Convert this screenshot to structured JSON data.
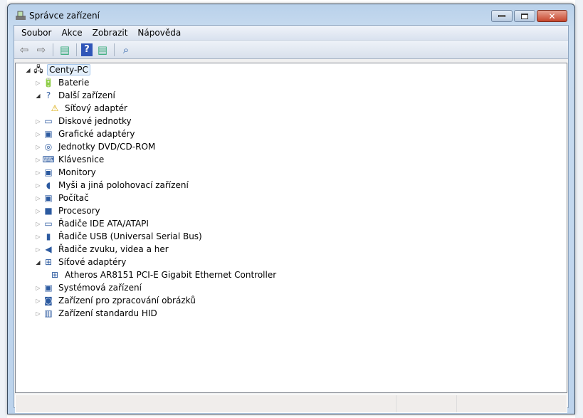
{
  "window": {
    "title": "Správce zařízení",
    "minimize": "—",
    "maximize": "□",
    "close": "✕"
  },
  "menu": [
    "Soubor",
    "Akce",
    "Zobrazit",
    "Nápověda"
  ],
  "toolbar": [
    {
      "name": "back",
      "glyph": "⇦"
    },
    {
      "name": "forward",
      "glyph": "⇨"
    },
    {
      "name": "show-hide-tree",
      "glyph": "▤"
    },
    {
      "name": "help",
      "glyph": "?"
    },
    {
      "name": "properties",
      "glyph": "▤"
    },
    {
      "name": "scan-hardware",
      "glyph": "⌕"
    }
  ],
  "tree": {
    "root": "Centy-PC",
    "items": [
      {
        "label": "Baterie",
        "level": 1,
        "expanded": false,
        "icon": "battery-icon",
        "glyph": "🔋"
      },
      {
        "label": "Další zařízení",
        "level": 1,
        "expanded": true,
        "icon": "unknown-device-icon",
        "glyph": "?"
      },
      {
        "label": "Síťový adaptér",
        "level": 2,
        "icon": "warning-device-icon",
        "glyph": "⚠"
      },
      {
        "label": "Diskové jednotky",
        "level": 1,
        "expanded": false,
        "icon": "disk-drive-icon",
        "glyph": "▭"
      },
      {
        "label": "Grafické adaptéry",
        "level": 1,
        "expanded": false,
        "icon": "display-adapter-icon",
        "glyph": "▣"
      },
      {
        "label": "Jednotky DVD/CD-ROM",
        "level": 1,
        "expanded": false,
        "icon": "dvd-drive-icon",
        "glyph": "◎"
      },
      {
        "label": "Klávesnice",
        "level": 1,
        "expanded": false,
        "icon": "keyboard-icon",
        "glyph": "⌨"
      },
      {
        "label": "Monitory",
        "level": 1,
        "expanded": false,
        "icon": "monitor-icon",
        "glyph": "▣"
      },
      {
        "label": "Myši a jiná polohovací zařízení",
        "level": 1,
        "expanded": false,
        "icon": "mouse-icon",
        "glyph": "◖"
      },
      {
        "label": "Počítač",
        "level": 1,
        "expanded": false,
        "icon": "computer-icon",
        "glyph": "▣"
      },
      {
        "label": "Procesory",
        "level": 1,
        "expanded": false,
        "icon": "processor-icon",
        "glyph": "■"
      },
      {
        "label": "Řadiče IDE ATA/ATAPI",
        "level": 1,
        "expanded": false,
        "icon": "ide-controller-icon",
        "glyph": "▭"
      },
      {
        "label": "Řadiče USB (Universal Serial Bus)",
        "level": 1,
        "expanded": false,
        "icon": "usb-icon",
        "glyph": "▮"
      },
      {
        "label": "Řadiče zvuku, videa a her",
        "level": 1,
        "expanded": false,
        "icon": "speaker-icon",
        "glyph": "◀"
      },
      {
        "label": "Síťové adaptéry",
        "level": 1,
        "expanded": true,
        "icon": "network-adapter-icon",
        "glyph": "⊞"
      },
      {
        "label": "Atheros AR8151 PCI-E Gigabit Ethernet Controller",
        "level": 2,
        "icon": "network-adapter-icon",
        "glyph": "⊞"
      },
      {
        "label": "Systémová zařízení",
        "level": 1,
        "expanded": false,
        "icon": "system-device-icon",
        "glyph": "▣"
      },
      {
        "label": "Zařízení pro zpracování obrázků",
        "level": 1,
        "expanded": false,
        "icon": "imaging-device-icon",
        "glyph": "◙"
      },
      {
        "label": "Zařízení standardu HID",
        "level": 1,
        "expanded": false,
        "icon": "hid-icon",
        "glyph": "▥"
      }
    ]
  },
  "status": [
    "",
    "",
    ""
  ]
}
